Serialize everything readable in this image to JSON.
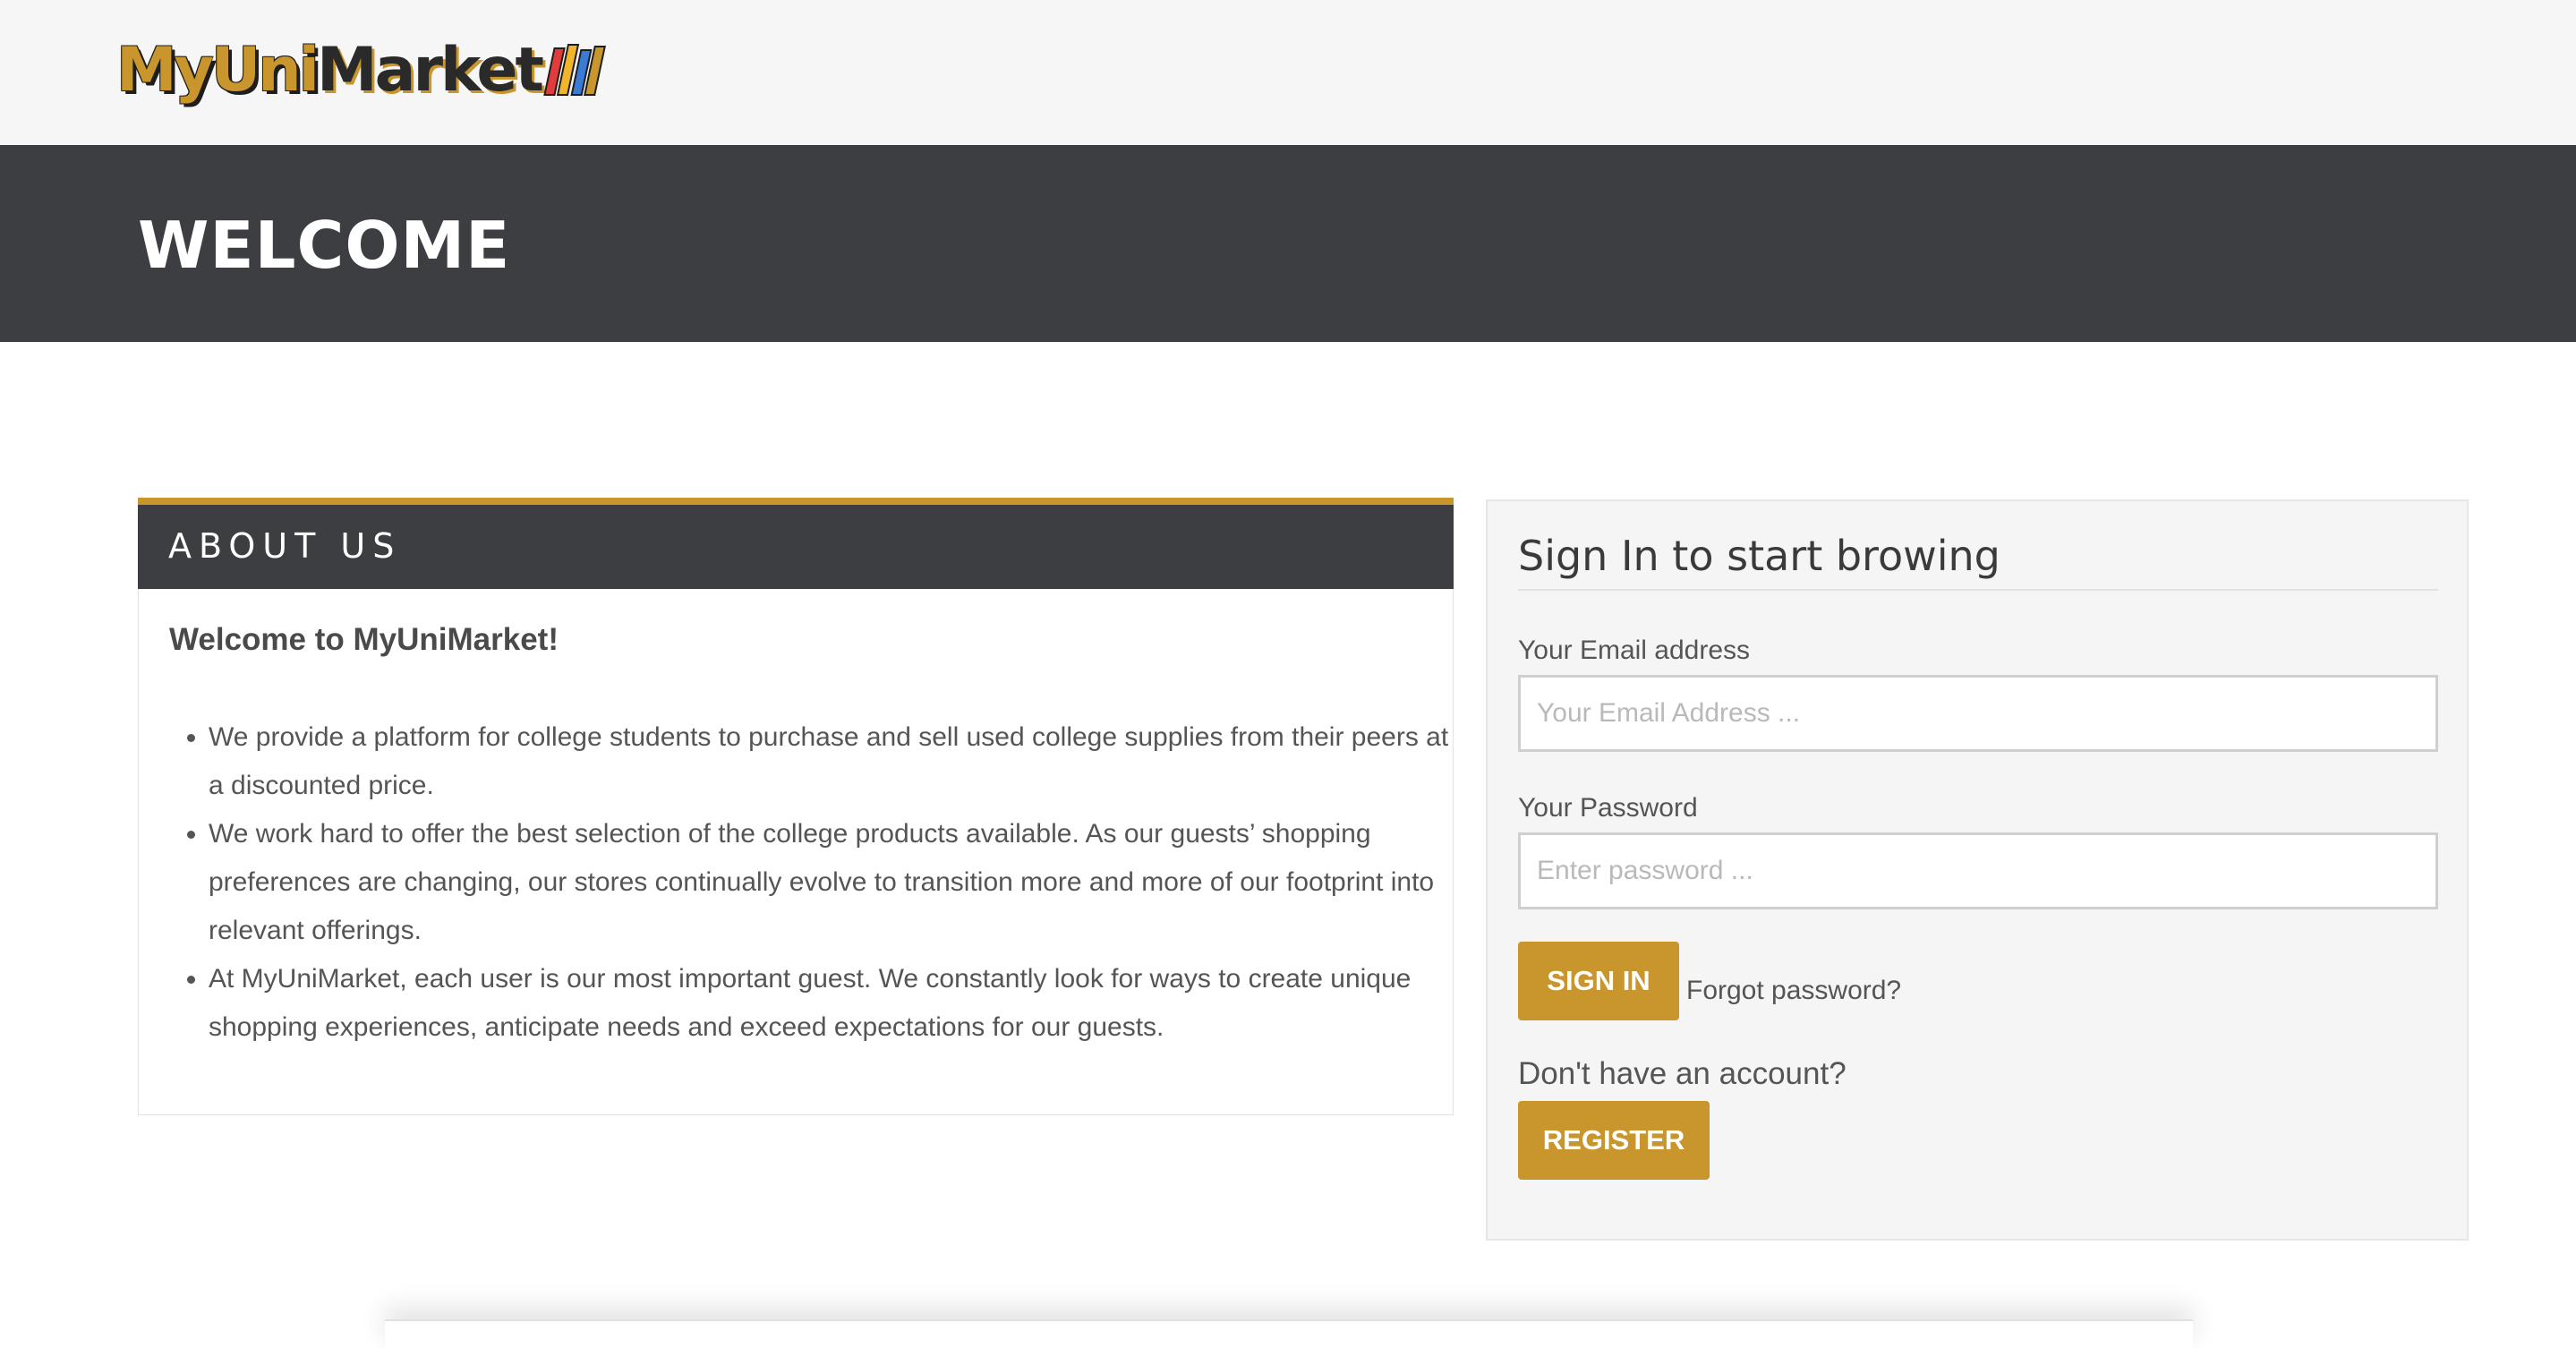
{
  "header": {
    "logo_text_part1": "MyUni",
    "logo_text_part2": "Market"
  },
  "banner": {
    "title": "WELCOME"
  },
  "about": {
    "heading": "ABOUT US",
    "welcome": "Welcome to MyUniMarket!",
    "points": [
      "We provide a platform for college students to purchase and sell used college supplies from their peers at a discounted price.",
      "We work hard to offer the best selection of the college products available. As our guests’ shopping preferences are changing, our stores continually evolve to transition more and more of our footprint into relevant offerings.",
      "At MyUniMarket, each user is our most important guest. We constantly look for ways to create unique shopping experiences, anticipate needs and exceed expectations for our guests."
    ]
  },
  "signin": {
    "title": "Sign In to start browing",
    "email_label": "Your Email address",
    "email_placeholder": "Your Email Address ...",
    "email_value": "",
    "password_label": "Your Password",
    "password_placeholder": "Enter password ...",
    "password_value": "",
    "signin_button": "SIGN IN",
    "forgot_link": "Forgot password?",
    "no_account_text": "Don't have an account?",
    "register_button": "REGISTER"
  },
  "colors": {
    "accent": "#c8962c",
    "dark_bar": "#3d3e41",
    "header_bg": "#f6f6f6",
    "panel_bg": "#f5f5f5"
  }
}
